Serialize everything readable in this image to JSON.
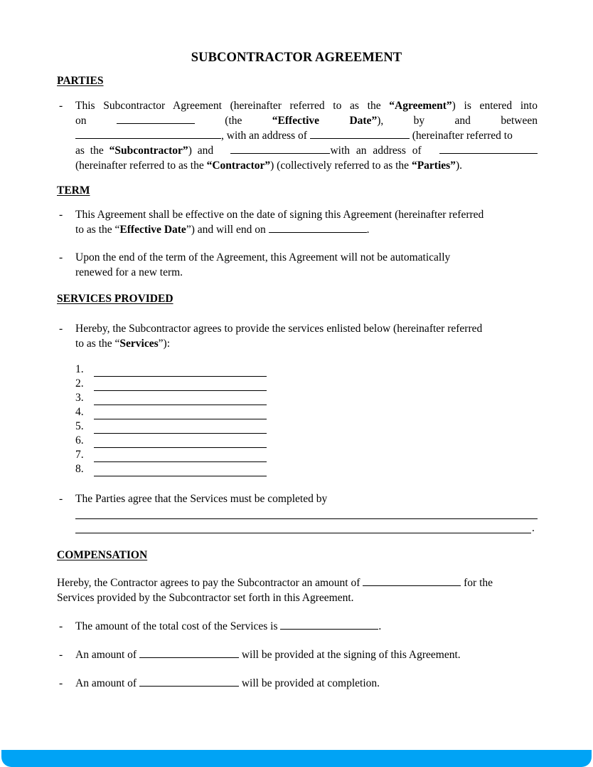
{
  "document": {
    "title": "SUBCONTRACTOR AGREEMENT",
    "sections": {
      "parties": {
        "heading": "PARTIES",
        "bullet": {
          "l1": "This Subcontractor Agreement (hereinafter referred to as the ",
          "l1_bold": "“Agreement”",
          "l1_end": ") is entered into",
          "l2_on": "on",
          "l2_the": "(the",
          "l2_eff": "“Effective",
          "l2_date": "Date”",
          "l2_paren": "),",
          "l2_by": "by",
          "l2_and": "and",
          "l2_between": "between",
          "l3_addr": ", with an address of ",
          "l3_end": " (hereinafter referred to",
          "l4_as": "as the ",
          "l4_bold": "“Subcontractor”",
          "l4_and": ") and ",
          "l4_addr": "with an address of ",
          "l5_start": "(hereinafter referred to as the ",
          "l5_bold1": "“Contractor”",
          "l5_mid": ") (collectively referred to as the ",
          "l5_bold2": "“Parties”",
          "l5_end": ")."
        }
      },
      "term": {
        "heading": "TERM",
        "bullet1": {
          "l1": "This Agreement shall be effective on the date of signing this Agreement (hereinafter referred",
          "l2_start": "to as the “",
          "l2_bold": "Effective Date",
          "l2_mid": "”) and will end on ",
          "l2_end": "."
        },
        "bullet2": {
          "l1": "Upon the end of the term of the Agreement, this Agreement will not be automatically",
          "l2": "renewed for a new term."
        }
      },
      "services": {
        "heading": "SERVICES PROVIDED",
        "bullet1": {
          "l1": "Hereby, the Subcontractor agrees to provide the services enlisted below (hereinafter referred",
          "l2_start": "to as the “",
          "l2_bold": "Services",
          "l2_end": "”):"
        },
        "items": [
          "1.",
          "2.",
          "3.",
          "4.",
          "5.",
          "6.",
          "7.",
          "8."
        ],
        "bullet2": {
          "l1": "The Parties agree that the Services must be completed by",
          "end": "."
        }
      },
      "compensation": {
        "heading": "COMPENSATION",
        "para": {
          "l1_start": "Hereby, the Contractor agrees to pay the Subcontractor an amount of ",
          "l1_end": " for the",
          "l2": "Services provided by the Subcontractor set forth in this Agreement."
        },
        "bullet1": {
          "start": "The amount of the total cost of the Services is ",
          "end": "."
        },
        "bullet2": {
          "start": "An amount of ",
          "end": " will be provided at the signing of this Agreement."
        },
        "bullet3": {
          "start": "An amount of ",
          "end": " will be provided at completion."
        }
      }
    },
    "bullet_char": "-",
    "accent_color": "#00a3f5"
  }
}
